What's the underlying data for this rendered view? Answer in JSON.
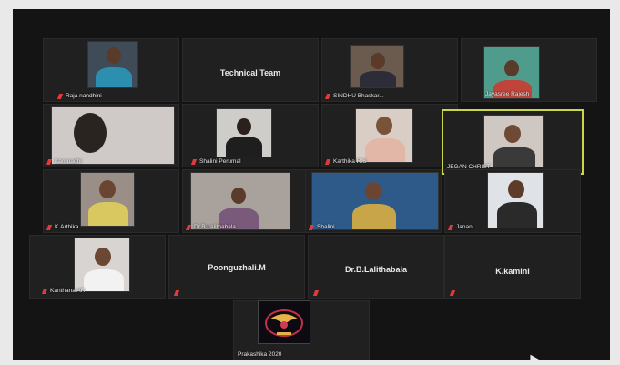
{
  "participants": {
    "raja_nandhini": "Raja nandhini",
    "technical_team": "Technical Team",
    "sindhu": "SINDHU Bhaskar...",
    "jayasree": "Jayasree Rajesh",
    "karunadhi": "Karunadhi",
    "shalini": "Shalini Perumal",
    "karthika_r": "Karthika R.S",
    "jegan_christ": "JEGAN CHRIST",
    "k_arthika": "K.Arthika",
    "dr_lalithabala_tile": "Dr.B.Lalithabala",
    "shalini_2": "Shalini",
    "janani": "Janani",
    "kanthana": "Kanthana AR",
    "poonguzhali": "Poonguzhali.M",
    "dr_lalithabala": "Dr.B.Lalithabala",
    "k_kamini": "K.kamini",
    "prakashika": "Prakashika 2020"
  },
  "colors": {
    "active_speaker_border": "#c9d648",
    "muted_mic": "#e03a3a"
  }
}
